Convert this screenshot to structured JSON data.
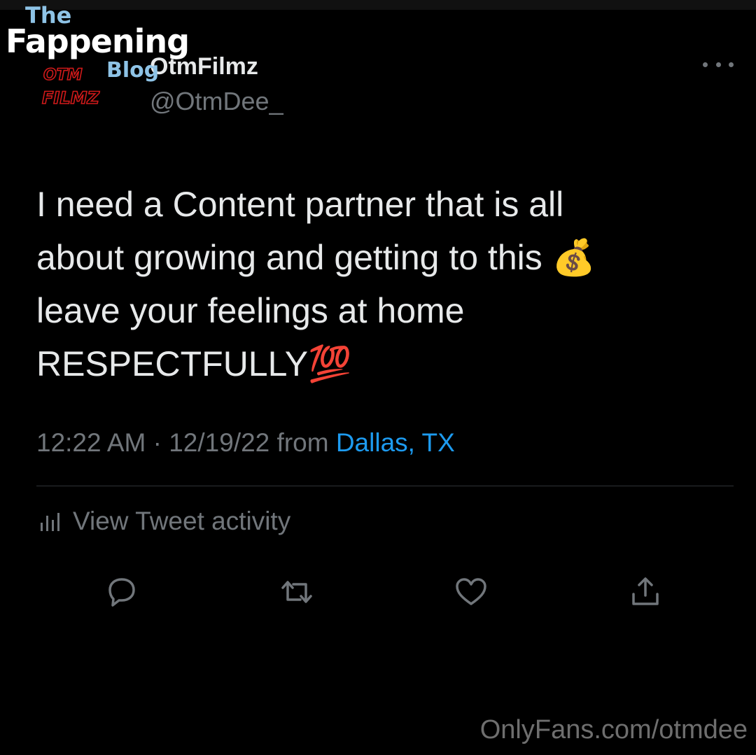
{
  "watermark": {
    "line1": "The",
    "line2": "Fappening",
    "line3": "Blog",
    "bottom": "OnlyFans.com/otmdee"
  },
  "avatar": {
    "logo_text_top": "OTM",
    "logo_text_bottom": "FILMZ",
    "logo_color": "#d11a1a"
  },
  "header": {
    "display_name": "OtmFilmz",
    "handle": "@OtmDee_",
    "more_icon": "more-horizontal-icon"
  },
  "tweet": {
    "text": "I need a Content partner that is all\nabout growing and getting to this 💰\nleave your feelings at home\nRESPECTFULLY💯",
    "time": "12:22 AM",
    "separator": " · ",
    "date": "12/19/22",
    "from_label": " from ",
    "location": "Dallas, TX"
  },
  "activity": {
    "label": "View Tweet activity",
    "icon": "analytics-icon"
  },
  "actions": [
    {
      "name": "reply",
      "icon": "reply-icon"
    },
    {
      "name": "retweet",
      "icon": "retweet-icon"
    },
    {
      "name": "like",
      "icon": "heart-icon"
    },
    {
      "name": "share",
      "icon": "share-icon"
    }
  ],
  "colors": {
    "background": "#000000",
    "text": "#e7e9ea",
    "secondary": "#71767b",
    "link": "#1d9bf0",
    "watermark_blue": "#8ec3e6"
  }
}
